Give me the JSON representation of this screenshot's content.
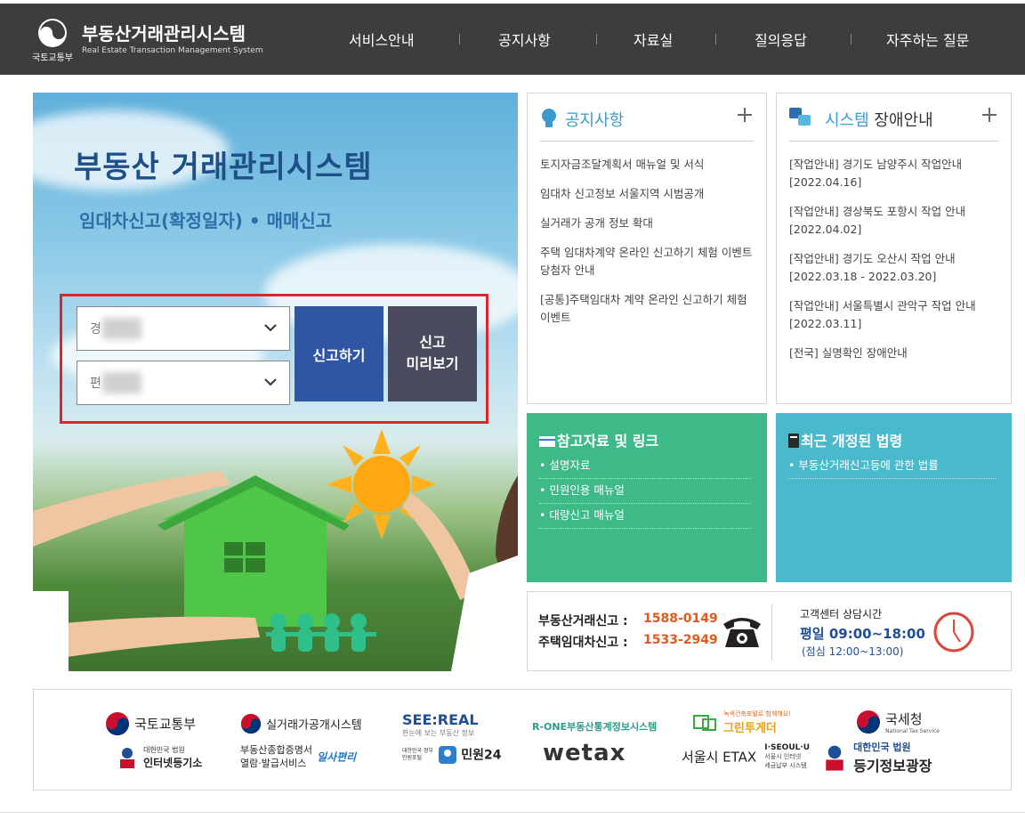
{
  "header": {
    "ministry": "국토교통부",
    "title": "부동산거래관리시스템",
    "subtitle": "Real Estate Transaction Management System",
    "nav": [
      "서비스안내",
      "공지사항",
      "자료실",
      "질의응답",
      "자주하는 질문"
    ]
  },
  "hero": {
    "title": "부동산 거래관리시스템",
    "subtitle": "임대차신고(확정일자) • 매매신고",
    "select1_prefix": "경",
    "select2_prefix": "편",
    "report_button": "신고하기",
    "preview_line1": "신고",
    "preview_line2": "미리보기"
  },
  "notice": {
    "title": "공지사항",
    "items": [
      "토지자금조달계획서 매뉴얼 및 서식",
      "임대차 신고정보 서울지역 시범공개",
      "실거래가 공개 정보 확대",
      "주택 임대차계약 온라인 신고하기 체험 이벤트 당첨자 안내",
      "[공통]주택임대차 계약 온라인 신고하기 체험 이벤트"
    ]
  },
  "outage": {
    "title_accent": "시스템",
    "title_rest": " 장애안내",
    "items": [
      "[작업안내] 경기도 남양주시 작업안내 [2022.04.16]",
      "[작업안내] 경상북도 포항시 작업 안내 [2022.04.02]",
      "[작업안내] 경기도 오산시 작업 안내 [2022.03.18 - 2022.03.20]",
      "[작업안내] 서울특별시 관악구 작업 안내 [2022.03.11]",
      "[전국] 실명확인 장애안내"
    ]
  },
  "references": {
    "title": "참고자료 및 링크",
    "items": [
      "설명자료",
      "민원인용 매뉴얼",
      "대량신고 매뉴얼"
    ]
  },
  "laws": {
    "title": "최근 개정된 법령",
    "items": [
      "부동산거래신고등에 관한 법률"
    ]
  },
  "contact": {
    "label1": "부동산거래신고 : ",
    "phone1": "1588-0149",
    "label2": "주택임대차신고 : ",
    "phone2": "1533-2949",
    "hours_title": "고객센터 상담시간",
    "hours": "평일 09:00~18:00",
    "lunch": "(점심 12:00~13:00)"
  },
  "partners": {
    "molit": "국토교통부",
    "court_small": "대한민국 법원",
    "internet_registry": "인터넷등기소",
    "price_system": "실거래가공개시스템",
    "cert_line1": "부동산종합증명서",
    "cert_line2": "열람·발급서비스",
    "ilsa": "일사편리",
    "seereal": "SEE:REAL",
    "seereal_sub": "한눈에 보는 부동산 정보",
    "minwon_small": "대한민국 정부민원포털",
    "minwon": "민원24",
    "rone": "R-ONE부동산통계정보시스템",
    "wetax": "wetax",
    "green_small": "녹색건축포털로 함께해요!",
    "green": "그린투게더",
    "etax": "서울시 ETAX",
    "iseoul": "I·SEOUL·U",
    "iseoul_sub1": "서울시 인터넷",
    "iseoul_sub2": "세금납부 시스템",
    "nts": "국세청",
    "nts_sub": "National Tax Service",
    "court2_small": "대한민국 법원",
    "registry_plaza": "등기정보광장"
  },
  "colors": {
    "header_bg": "#3d3d3d",
    "report_button": "#2f55a4",
    "preview_button": "#4a4a5e",
    "references_bg": "#3dba88",
    "laws_bg": "#49b9cb",
    "phone": "#e05a1e",
    "accent_blue": "#3a9ad0"
  }
}
